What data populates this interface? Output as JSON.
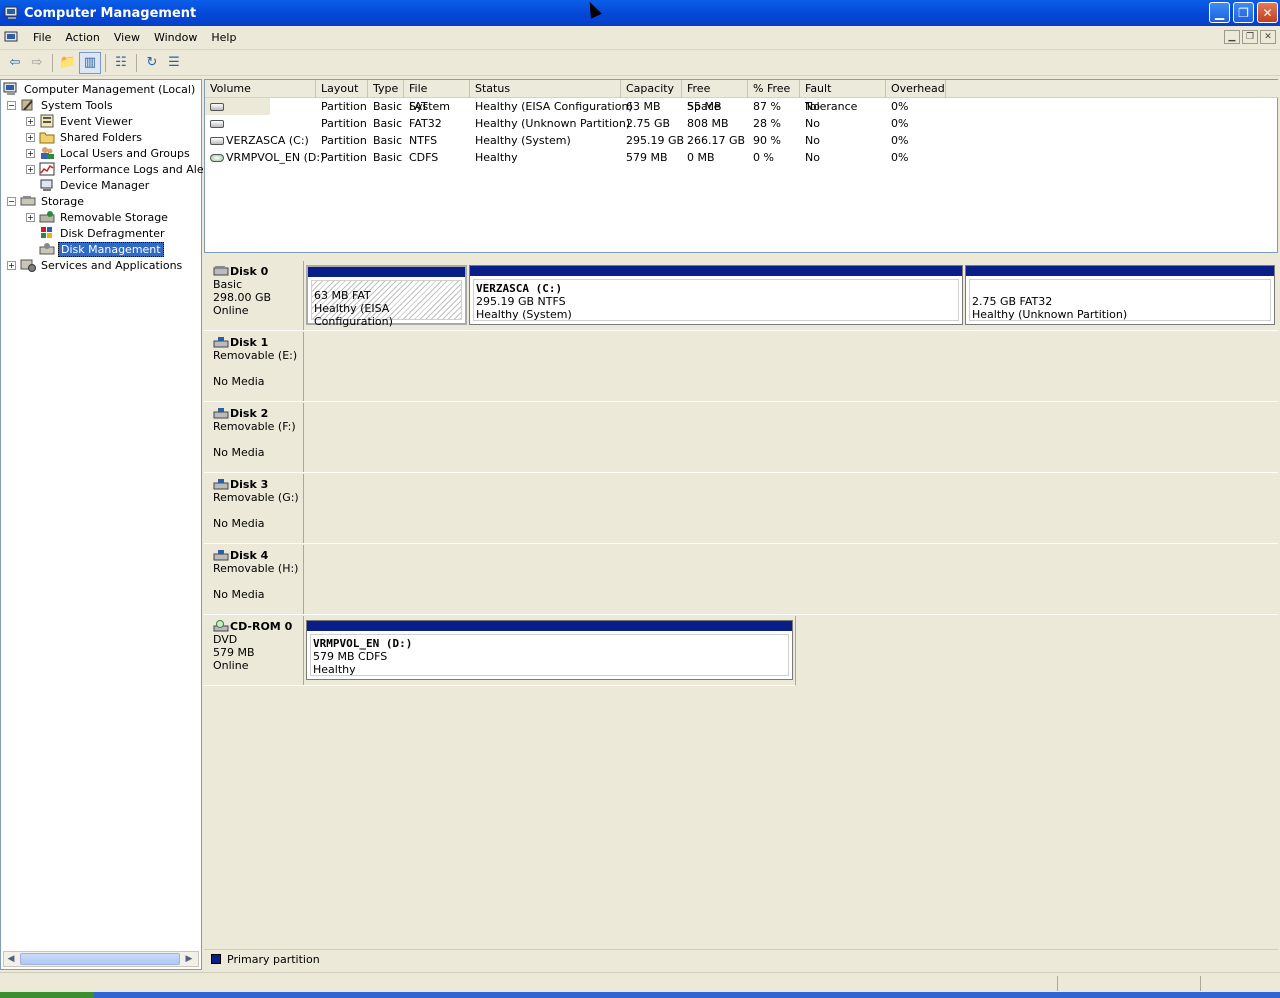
{
  "window": {
    "title": "Computer Management"
  },
  "menubar": {
    "items": [
      "File",
      "Action",
      "View",
      "Window",
      "Help"
    ]
  },
  "toolbar": {
    "buttons": [
      "back-icon",
      "forward-icon",
      "up-folder-icon",
      "show-hide-tree-icon",
      "properties-icon",
      "refresh-icon",
      "export-list-icon"
    ]
  },
  "tree": {
    "root": "Computer Management (Local)",
    "system_tools": "System Tools",
    "event_viewer": "Event Viewer",
    "shared_folders": "Shared Folders",
    "local_users": "Local Users and Groups",
    "perf_logs": "Performance Logs and Alerts",
    "device_manager": "Device Manager",
    "storage": "Storage",
    "removable_storage": "Removable Storage",
    "disk_defrag": "Disk Defragmenter",
    "disk_management": "Disk Management",
    "services_apps": "Services and Applications"
  },
  "volume_list": {
    "columns": [
      "Volume",
      "Layout",
      "Type",
      "File System",
      "Status",
      "Capacity",
      "Free Space",
      "% Free",
      "Fault Tolerance",
      "Overhead"
    ],
    "rows": [
      {
        "volume": "",
        "layout": "Partition",
        "type": "Basic",
        "fs": "FAT",
        "status": "Healthy (EISA Configuration)",
        "capacity": "63 MB",
        "free": "55 MB",
        "pct": "87 %",
        "fault": "No",
        "overhead": "0%"
      },
      {
        "volume": "",
        "layout": "Partition",
        "type": "Basic",
        "fs": "FAT32",
        "status": "Healthy (Unknown Partition)",
        "capacity": "2.75 GB",
        "free": "808 MB",
        "pct": "28 %",
        "fault": "No",
        "overhead": "0%"
      },
      {
        "volume": "VERZASCA (C:)",
        "layout": "Partition",
        "type": "Basic",
        "fs": "NTFS",
        "status": "Healthy (System)",
        "capacity": "295.19 GB",
        "free": "266.17 GB",
        "pct": "90 %",
        "fault": "No",
        "overhead": "0%"
      },
      {
        "volume": "VRMPVOL_EN (D:)",
        "layout": "Partition",
        "type": "Basic",
        "fs": "CDFS",
        "status": "Healthy",
        "capacity": "579 MB",
        "free": "0 MB",
        "pct": "0 %",
        "fault": "No",
        "overhead": "0%"
      }
    ]
  },
  "disks": {
    "disk0": {
      "name": "Disk 0",
      "l1": "Basic",
      "l2": "298.00 GB",
      "l3": "Online",
      "p1": {
        "l1": "63 MB FAT",
        "l2": "Healthy (EISA Configuration)"
      },
      "p2": {
        "name": "VERZASCA (C:)",
        "l1": "295.19 GB NTFS",
        "l2": "Healthy (System)"
      },
      "p3": {
        "l1": "2.75 GB FAT32",
        "l2": "Healthy (Unknown Partition)"
      }
    },
    "disk1": {
      "name": "Disk 1",
      "l1": "Removable (E:)",
      "l3": "No Media"
    },
    "disk2": {
      "name": "Disk 2",
      "l1": "Removable (F:)",
      "l3": "No Media"
    },
    "disk3": {
      "name": "Disk 3",
      "l1": "Removable (G:)",
      "l3": "No Media"
    },
    "disk4": {
      "name": "Disk 4",
      "l1": "Removable (H:)",
      "l3": "No Media"
    },
    "cdrom0": {
      "name": "CD-ROM 0",
      "l1": "DVD",
      "l2": "579 MB",
      "l3": "Online",
      "p1": {
        "name": "VRMPVOL_EN (D:)",
        "l1": "579 MB CDFS",
        "l2": "Healthy"
      }
    }
  },
  "legend": {
    "primary": "Primary partition",
    "primary_color": "#0a1e88"
  }
}
